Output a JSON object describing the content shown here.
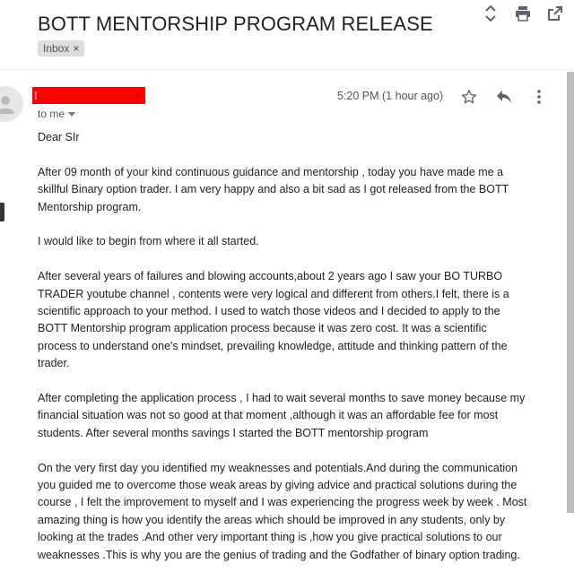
{
  "subject": "BOTT MENTORSHIP PROGRAM RELEASE",
  "label": "Inbox",
  "label_close": "×",
  "sender_name": "I",
  "sender_tail": ".",
  "recipient": "to me",
  "time": "5:20 PM (1 hour ago)",
  "icons": {
    "top": [
      "expand-collapse-icon",
      "print-icon",
      "open-in-new-window-icon"
    ],
    "message": [
      "star-icon",
      "reply-icon",
      "more-options-icon"
    ]
  },
  "body": {
    "p1": "Dear SIr",
    "p2": "After 09 month of your kind continuous guidance and mentorship , today you have made me a\nskillful Binary option trader. I am very happy and also a bit sad as I got released from the BOTT\nMentorship program.",
    "p3": "I would like to begin from where it all started.",
    "p4": "After several years of failures and blowing accounts,about 2 years ago I saw your BO TURBO\nTRADER youtube channel , contents were very logical and different from others.I felt, there is a\nscientific approach to your method. I used to watch those videos and I decided to apply to the\nBOTT Mentorship program application process because it was zero cost. It was a scientific\nprocess to understand one's mindset, prevailing knowledge, attitude and thinking pattern of the\ntrader.",
    "p5": "After completing the application process , I had to wait several months to save money because my\nfinancial situation was not so good at that moment ,although it was an affordable fee for most\nstudents. After several months savings I started the BOTT mentorship program",
    "p6": "On the very first day you identified my weaknesses and potentials.And during the communication\nyou guided me to overcome those weak areas by giving advice and practical solutions during the\ncourse , I felt the improvement to myself and I was experiencing the progress week by week . Most\namazing thing is how you identify the areas which should be improved in any students, only by\nlooking at the trades .And other very important thing is ,how you give practical solutions to our\nweaknesses .This is why you are the genius of trading and the Godfather of binary option trading."
  }
}
